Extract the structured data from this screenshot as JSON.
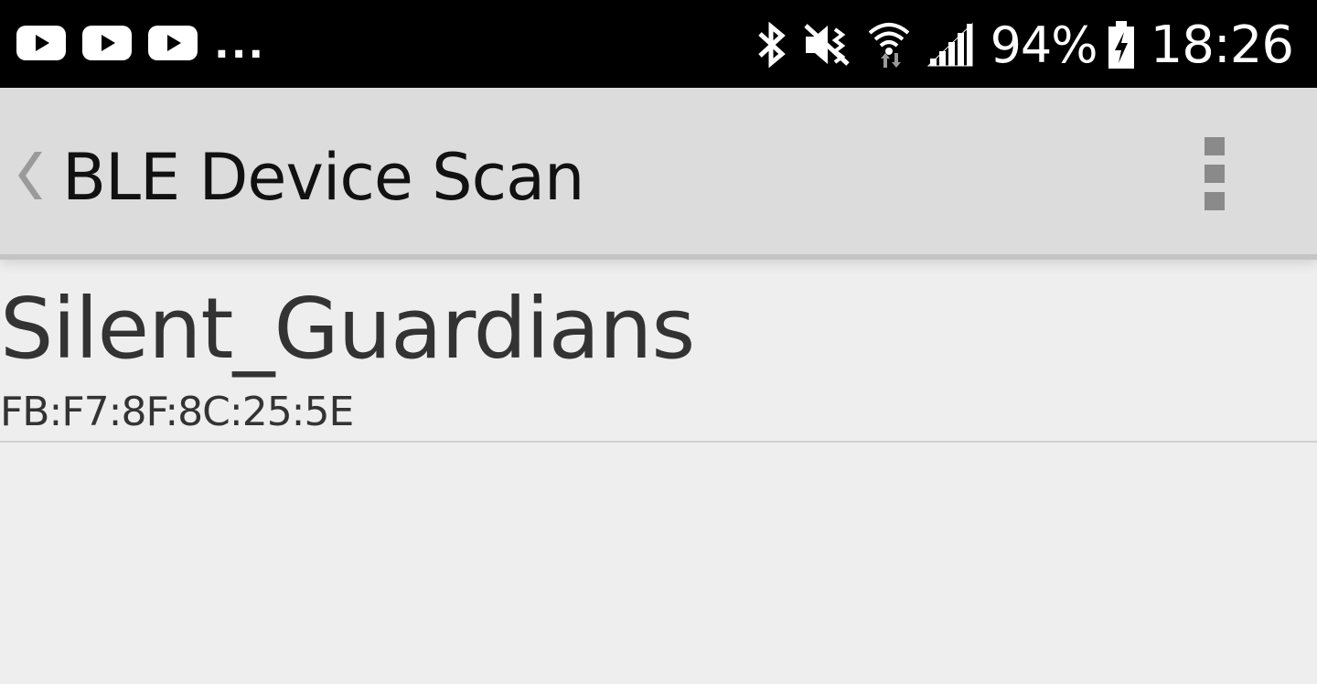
{
  "status_bar": {
    "notifications": [
      "youtube-icon",
      "youtube-icon",
      "youtube-icon"
    ],
    "more_indicator": "...",
    "system_icons": [
      "bluetooth-icon",
      "vibrate-mute-icon",
      "wifi-icon",
      "cell-signal-icon"
    ],
    "battery_percent": "94%",
    "battery_icon": "battery-charging-icon",
    "time": "18:26",
    "background_color": "#000000",
    "text_color": "#ffffff"
  },
  "action_bar": {
    "back_icon": "chevron-left-icon",
    "title": "BLE Device Scan",
    "overflow_icon": "overflow-menu-icon",
    "background_color": "#dcdcdc"
  },
  "devices": [
    {
      "name": "Silent_Guardians",
      "address": "FB:F7:8F:8C:25:5E"
    }
  ],
  "colors": {
    "page_background": "#eeeeee",
    "primary_text": "#333333",
    "divider": "#d0d0d0"
  }
}
